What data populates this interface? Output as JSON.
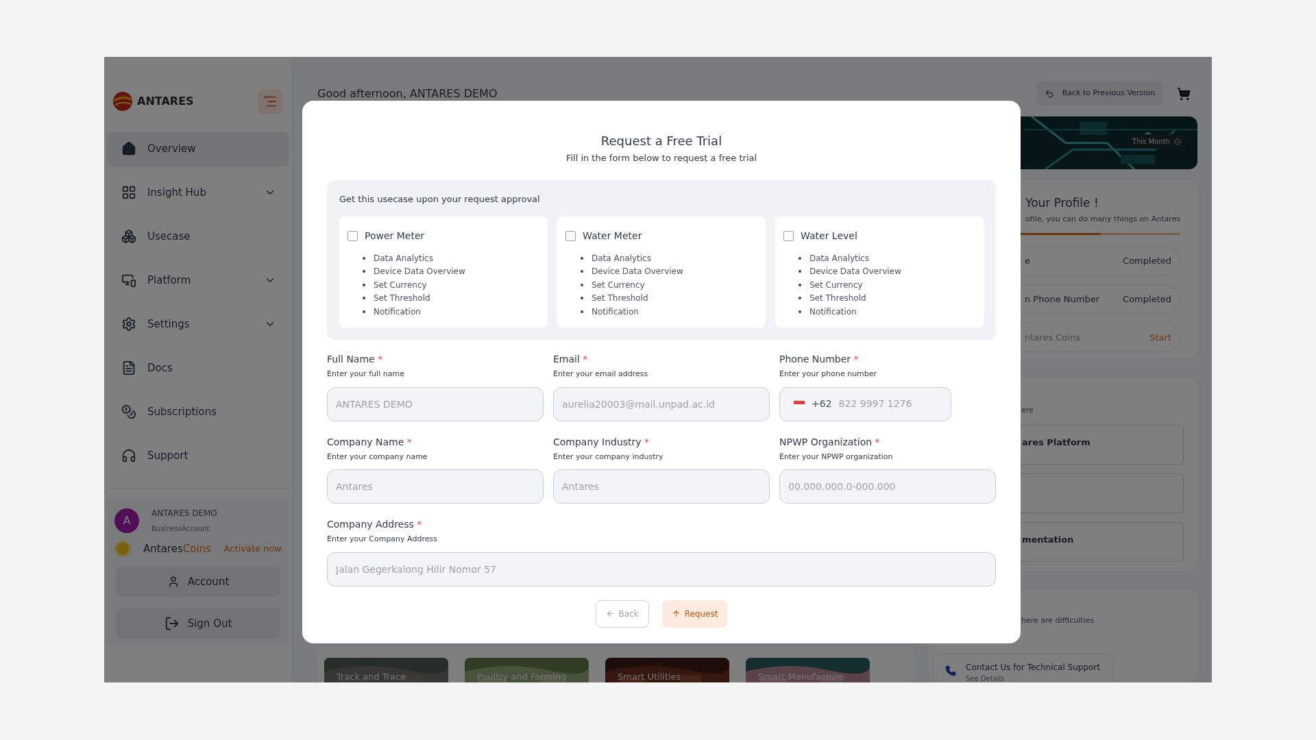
{
  "sidebar": {
    "brand": "ANTARES",
    "items": [
      {
        "label": "Overview",
        "selected": true,
        "expandable": false,
        "kind": "home"
      },
      {
        "label": "Insight Hub",
        "selected": false,
        "expandable": true,
        "kind": "grid"
      },
      {
        "label": "Usecase",
        "selected": false,
        "expandable": false,
        "kind": "cubes"
      },
      {
        "label": "Platform",
        "selected": false,
        "expandable": true,
        "kind": "devices"
      },
      {
        "label": "Settings",
        "selected": false,
        "expandable": true,
        "kind": "gear"
      },
      {
        "label": "Docs",
        "selected": false,
        "expandable": false,
        "kind": "document"
      },
      {
        "label": "Subscriptions",
        "selected": false,
        "expandable": false,
        "kind": "coins"
      },
      {
        "label": "Support",
        "selected": false,
        "expandable": false,
        "kind": "headset"
      }
    ],
    "user": {
      "initial": "A",
      "name": "ANTARES DEMO",
      "account_type": "BusinessAccount"
    },
    "coins": {
      "label_start": "Antares",
      "label_end": "Coins",
      "action": "Activate now"
    },
    "buttons": [
      {
        "label": "Account",
        "kind": "account"
      },
      {
        "label": "Sign Out",
        "kind": "signout"
      }
    ]
  },
  "header": {
    "greeting": "Good afternoon, ANTARES DEMO",
    "back_button": "Back to Previous Version"
  },
  "banner": {
    "badge": "This Month"
  },
  "profile_card": {
    "title": "Your Profile !",
    "subtitle": "ofile, you can do many things on Antares",
    "progress": {
      "level": 0.66
    },
    "steps": [
      {
        "label": "e",
        "status": "Completed",
        "kind": "done"
      },
      {
        "label": "n Phone Number",
        "status": "Completed",
        "kind": "done"
      },
      {
        "label": "ntares Coins",
        "status": "Start",
        "kind": "pending"
      }
    ]
  },
  "resources_card": {
    "subtitle": "ere",
    "links": [
      {
        "kind": "titled",
        "title": "ares Platform"
      },
      {
        "kind": "blank"
      },
      {
        "kind": "titled",
        "title": "mentation"
      }
    ]
  },
  "support_card": {
    "subtitle": "here are difficulties",
    "contact": {
      "title": "Contact Us for Technical Support",
      "link": "See Details"
    }
  },
  "usecase_tiles": [
    {
      "label": "Track and Trace",
      "kind": "field"
    },
    {
      "label": "Poultry and Farming",
      "kind": "farm"
    },
    {
      "label": "Smart Utilities",
      "kind": "brick"
    },
    {
      "label": "Smart Manufacture",
      "kind": "factory"
    }
  ],
  "modal": {
    "title": "Request a Free Trial",
    "subtitle": "Fill in the form below to request a free trial",
    "usecase_section": {
      "heading": "Get this usecase upon your request approval",
      "options": [
        {
          "label": "Power Meter",
          "checked": false,
          "features": [
            "Data Analytics",
            "Device Data Overview",
            "Set Currency",
            "Set Threshold",
            "Notification"
          ]
        },
        {
          "label": "Water Meter",
          "checked": false,
          "features": [
            "Data Analytics",
            "Device Data Overview",
            "Set Currency",
            "Set Threshold",
            "Notification"
          ]
        },
        {
          "label": "Water Level",
          "checked": false,
          "features": [
            "Data Analytics",
            "Device Data Overview",
            "Set Currency",
            "Set Threshold",
            "Notification"
          ]
        }
      ]
    },
    "fields": [
      {
        "label": "Full Name",
        "required_mark": "*",
        "hint": "Enter your full name",
        "kind": "text",
        "value": "ANTARES DEMO"
      },
      {
        "label": "Email",
        "required_mark": "*",
        "hint": "Enter your email address",
        "kind": "text",
        "value": "aurelia20003@mail.unpad.ac.id"
      },
      {
        "label": "Phone Number",
        "required_mark": "*",
        "hint": "Enter your phone number",
        "kind": "phone",
        "country_code": "+62",
        "value": "822 9997 1276"
      },
      {
        "label": "Company Name",
        "required_mark": "*",
        "hint": "Enter your company name",
        "kind": "text",
        "placeholder": "Antares"
      },
      {
        "label": "Company Industry",
        "required_mark": "*",
        "hint": "Enter your company industry",
        "kind": "text",
        "placeholder": "Antares"
      },
      {
        "label": "NPWP Organization",
        "required_mark": "*",
        "hint": "Enter your NPWP organization",
        "kind": "text",
        "placeholder": "00.000.000.0-000.000"
      },
      {
        "label": "Company Address",
        "required_mark": "*",
        "hint": "Enter your Company Address",
        "kind": "wide",
        "placeholder": "Jalan Gegerkalong Hilir Nomor 57"
      }
    ],
    "buttons": [
      {
        "label": "Back",
        "kind": "secondary"
      },
      {
        "label": "Request",
        "kind": "primary"
      }
    ]
  }
}
